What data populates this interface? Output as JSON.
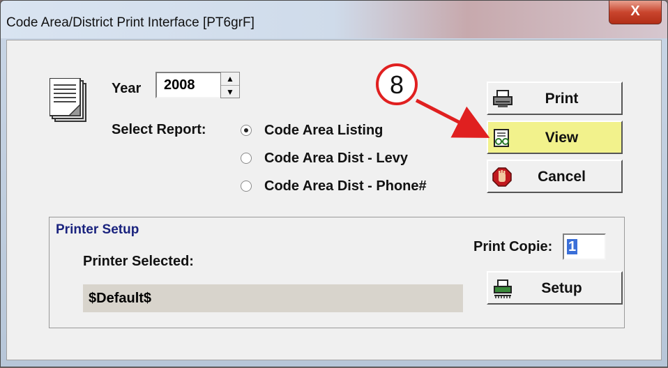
{
  "window": {
    "title": "Code Area/District Print Interface [PT6grF]",
    "close_label": "X"
  },
  "year": {
    "label": "Year",
    "value": "2008"
  },
  "report": {
    "label": "Select Report:",
    "options": [
      "Code Area Listing",
      "Code Area Dist - Levy",
      "Code Area Dist - Phone#"
    ],
    "selected": "Code Area Listing"
  },
  "buttons": {
    "print": "Print",
    "view": "View",
    "cancel": "Cancel",
    "setup": "Setup"
  },
  "printer_setup": {
    "title": "Printer Setup",
    "selected_label": "Printer Selected:",
    "selected_value": "$Default$",
    "copies_label": "Print Copie:",
    "copies_value": "1"
  },
  "annotation": {
    "step": "8"
  },
  "colors": {
    "view_highlight": "#f2f28c",
    "annotation_red": "#e02020",
    "group_title": "#1a237e"
  }
}
